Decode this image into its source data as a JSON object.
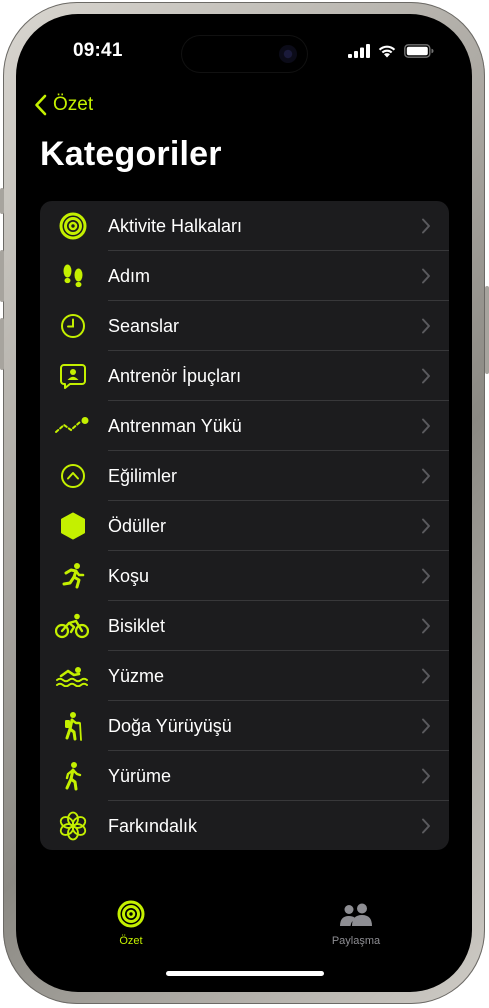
{
  "status_bar": {
    "time": "09:41"
  },
  "nav": {
    "back_label": "Özet",
    "title": "Kategoriler"
  },
  "colors": {
    "accent": "#c4f000",
    "background": "#000000",
    "card": "#1c1c1e",
    "separator": "#38383a",
    "inactive": "#8e8e93"
  },
  "categories": [
    {
      "label": "Aktivite Halkaları",
      "icon": "activity-rings-icon"
    },
    {
      "label": "Adım",
      "icon": "footprints-icon"
    },
    {
      "label": "Seanslar",
      "icon": "clock-icon"
    },
    {
      "label": "Antrenör İpuçları",
      "icon": "coach-message-icon"
    },
    {
      "label": "Antrenman Yükü",
      "icon": "training-load-icon"
    },
    {
      "label": "Eğilimler",
      "icon": "trends-icon"
    },
    {
      "label": "Ödüller",
      "icon": "awards-icon"
    },
    {
      "label": "Koşu",
      "icon": "running-icon"
    },
    {
      "label": "Bisiklet",
      "icon": "cycling-icon"
    },
    {
      "label": "Yüzme",
      "icon": "swimming-icon"
    },
    {
      "label": "Doğa Yürüyüşü",
      "icon": "hiking-icon"
    },
    {
      "label": "Yürüme",
      "icon": "walking-icon"
    },
    {
      "label": "Farkındalık",
      "icon": "mindfulness-icon"
    }
  ],
  "tab_bar": [
    {
      "label": "Özet",
      "icon": "activity-rings-icon",
      "active": true
    },
    {
      "label": "Paylaşma",
      "icon": "people-icon",
      "active": false
    }
  ]
}
